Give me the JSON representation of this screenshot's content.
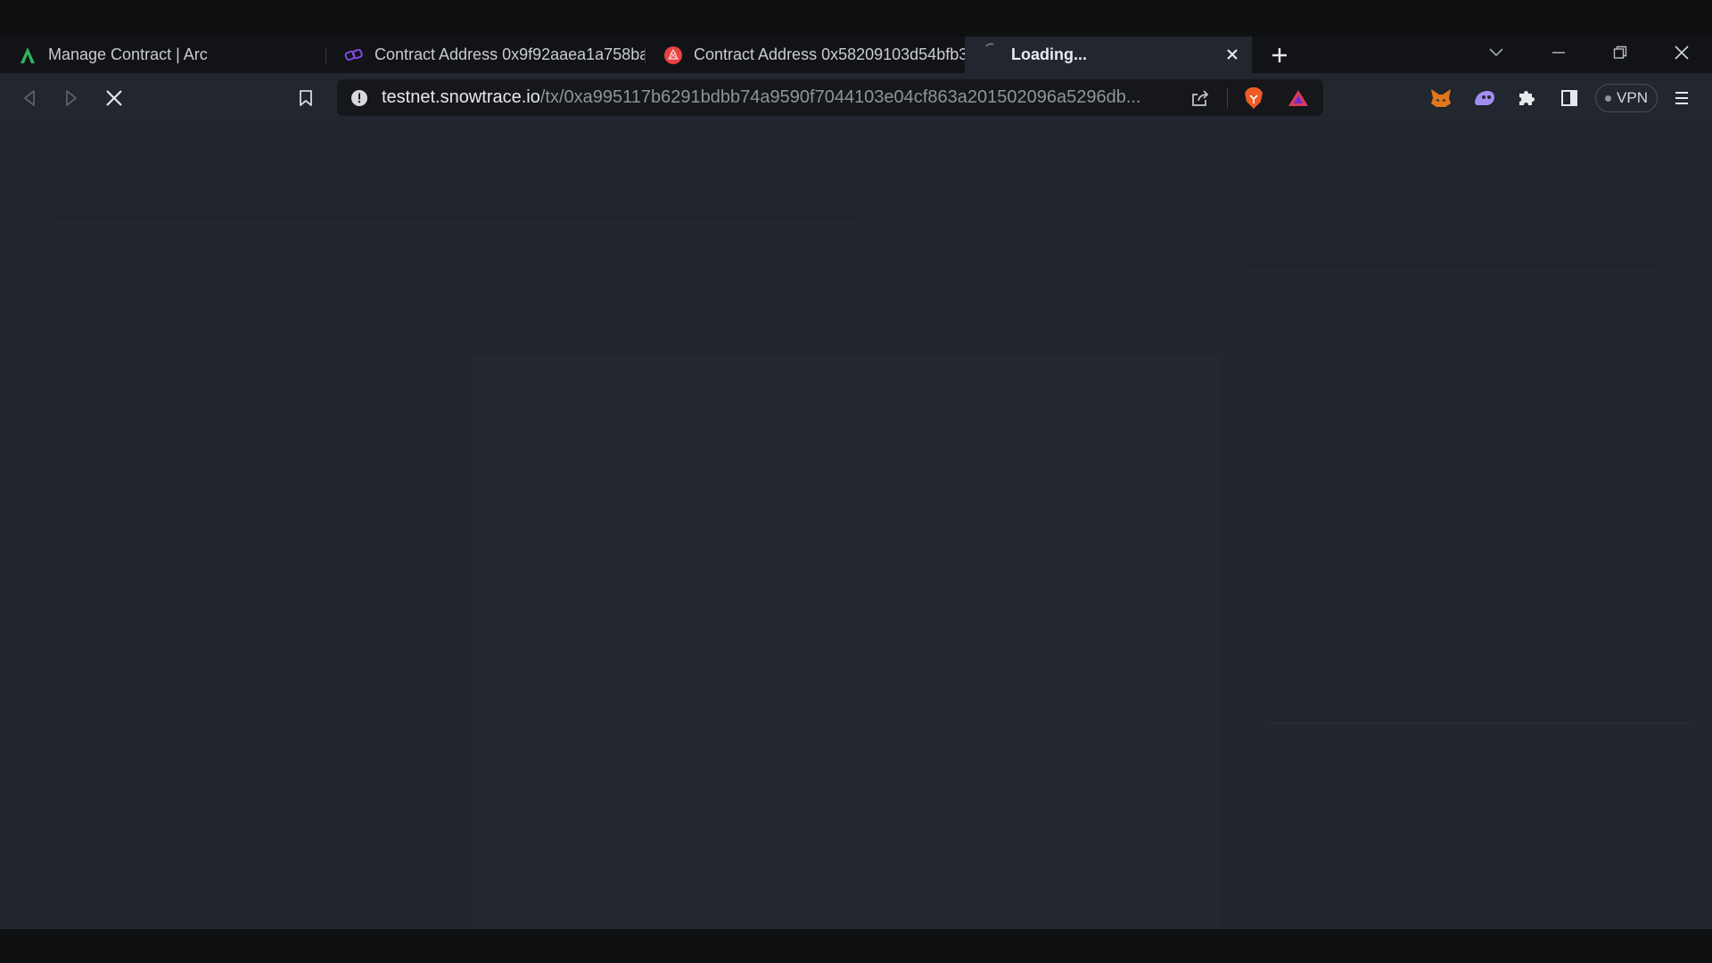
{
  "tabs": [
    {
      "title": "Manage Contract | Arc",
      "favicon": "arc-logo-icon",
      "active": false
    },
    {
      "title": "Contract Address 0x9f92aaea1a758ba",
      "favicon": "chain-link-icon",
      "active": false
    },
    {
      "title": "Contract Address 0x58209103d54bfb3",
      "favicon": "avalanche-icon",
      "active": false
    },
    {
      "title": "Loading...",
      "favicon": "loading-icon",
      "active": true
    }
  ],
  "address_bar": {
    "host": "testnet.snowtrace.io",
    "path": "/tx/0xa995117b6291bdbb74a9590f7044103e04cf863a201502096a5296db..."
  },
  "vpn": {
    "label": "VPN"
  },
  "colors": {
    "background": "#21252d",
    "chrome": "#121316",
    "accent_arc": "#2db55d",
    "accent_polygon": "#8247e5",
    "accent_avalanche": "#e84142"
  }
}
